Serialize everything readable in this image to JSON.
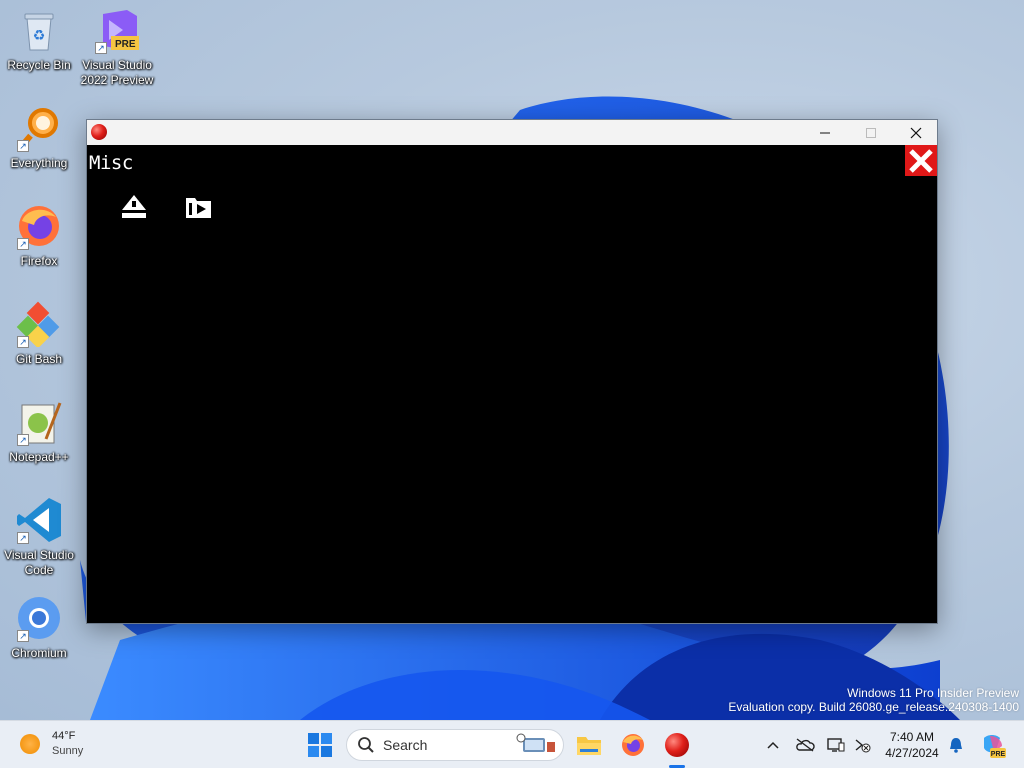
{
  "desktop": {
    "icons": [
      {
        "label": "Recycle Bin",
        "icon": "recycle-bin-icon"
      },
      {
        "label": "Visual Studio\n2022 Preview",
        "icon": "visual-studio-preview-icon",
        "badge": "PRE"
      },
      {
        "label": "Everything",
        "icon": "everything-search-icon"
      },
      {
        "label": "Firefox",
        "icon": "firefox-icon"
      },
      {
        "label": "Git Bash",
        "icon": "git-bash-icon"
      },
      {
        "label": "Notepad++",
        "icon": "notepad-plus-plus-icon"
      },
      {
        "label": "Visual Studio\nCode",
        "icon": "vscode-icon"
      },
      {
        "label": "Chromium",
        "icon": "chromium-icon"
      }
    ]
  },
  "window": {
    "title_icon": "app-red-ball-icon",
    "controls": {
      "minimize": "—",
      "maximize": "☐",
      "close": "✕"
    },
    "content": {
      "heading": "Misc",
      "tools": [
        {
          "icon": "eject-icon"
        },
        {
          "icon": "folder-play-icon"
        }
      ],
      "exit_icon": "close-x-icon"
    }
  },
  "watermark": {
    "line1": "Windows 11 Pro Insider Preview",
    "line2": "Evaluation copy. Build 26080.ge_release.240308-1400"
  },
  "taskbar": {
    "weather": {
      "temp": "44°F",
      "condition": "Sunny"
    },
    "search": {
      "placeholder": "Search"
    },
    "clock": {
      "time": "7:40 AM",
      "date": "4/27/2024"
    },
    "colors": {
      "accent": "#1a73e8",
      "exit_red": "#e01818"
    }
  }
}
